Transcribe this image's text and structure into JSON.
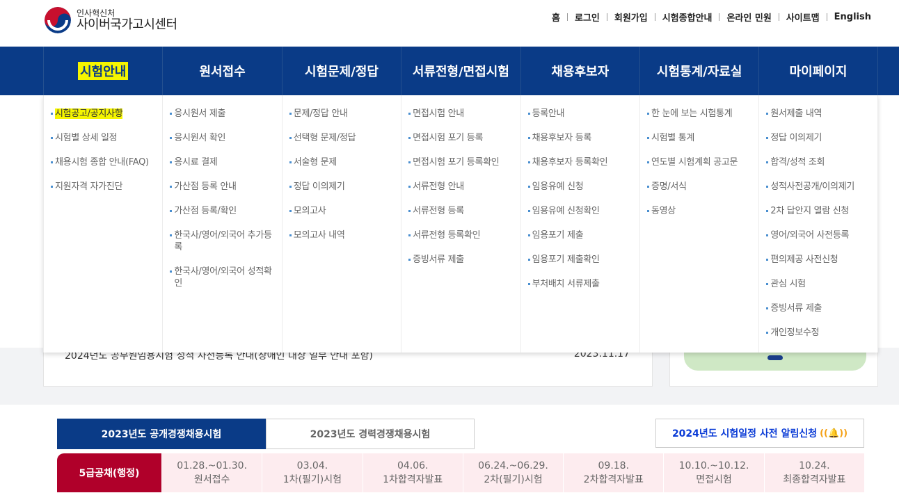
{
  "logo": {
    "sub": "인사혁신처",
    "main": "사이버국가고시센터"
  },
  "util": [
    "홈",
    "로그인",
    "회원가입",
    "시험종합안내",
    "온라인 민원",
    "사이트맵",
    "English"
  ],
  "gnb": [
    {
      "label": "시험안내",
      "subs": [
        "시험공고/공지사항",
        "시험별 상세 일정",
        "채용시험 종합 안내(FAQ)",
        "지원자격 자가진단"
      ]
    },
    {
      "label": "원서접수",
      "subs": [
        "응시원서 제출",
        "응시원서 확인",
        "응시료 결제",
        "가산점 등록 안내",
        "가산점 등록/확인",
        "한국사/영어/외국어 추가등록",
        "한국사/영어/외국어 성적확인"
      ]
    },
    {
      "label": "시험문제/정답",
      "subs": [
        "문제/정답 안내",
        "선택형 문제/정답",
        "서술형 문제",
        "정답 이의제기",
        "모의고사",
        "모의고사 내역"
      ]
    },
    {
      "label": "서류전형/면접시험",
      "subs": [
        "면접시험 안내",
        "면접시험 포기 등록",
        "면접시험 포기 등록확인",
        "서류전형 안내",
        "서류전형 등록",
        "서류전형 등록확인",
        "증빙서류 제출"
      ]
    },
    {
      "label": "채용후보자",
      "subs": [
        "등록안내",
        "채용후보자 등록",
        "채용후보자 등록확인",
        "임용유예 신청",
        "임용유예 신청확인",
        "임용포기 제출",
        "임용포기 제출확인",
        "부처배치 서류제출"
      ]
    },
    {
      "label": "시험통계/자료실",
      "subs": [
        "한 눈에 보는 시험통계",
        "시험별 통계",
        "연도별 시험계획 공고문",
        "증명/서식",
        "동영상"
      ]
    },
    {
      "label": "마이페이지",
      "subs": [
        "원서제출 내역",
        "정답 이의제기",
        "합격/성적 조회",
        "성적사전공개/이의제기",
        "2차 답안지 열람 신청",
        "영어/외국어 사전등록",
        "편의제공 사전신청",
        "관심 시험",
        "증빙서류 제출",
        "개인정보수정"
      ]
    }
  ],
  "notice": {
    "text": "2024년도 공무원임용시험 성적 사전등록 안내(장애인 대상 일부 안내 포함)",
    "date": "2023.11.17"
  },
  "tabs": {
    "active": "2023년도 공개경쟁채용시험",
    "inactive": "2023년도 경력경쟁채용시험",
    "alert": "2024년도 시험일정 사전 알림신청"
  },
  "schedule": {
    "label": "5급공채(행정)",
    "items": [
      {
        "date": "01.28.~01.30.",
        "event": "원서접수"
      },
      {
        "date": "03.04.",
        "event": "1차(필기)시험"
      },
      {
        "date": "04.06.",
        "event": "1차합격자발표"
      },
      {
        "date": "06.24.~06.29.",
        "event": "2차(필기)시험"
      },
      {
        "date": "09.18.",
        "event": "2차합격자발표"
      },
      {
        "date": "10.10.~10.12.",
        "event": "면접시험"
      },
      {
        "date": "10.24.",
        "event": "최종합격자발표"
      }
    ]
  },
  "colors": {
    "navy": "#0a3b87",
    "highlight": "#f5f500",
    "accent": "#b0002a"
  }
}
